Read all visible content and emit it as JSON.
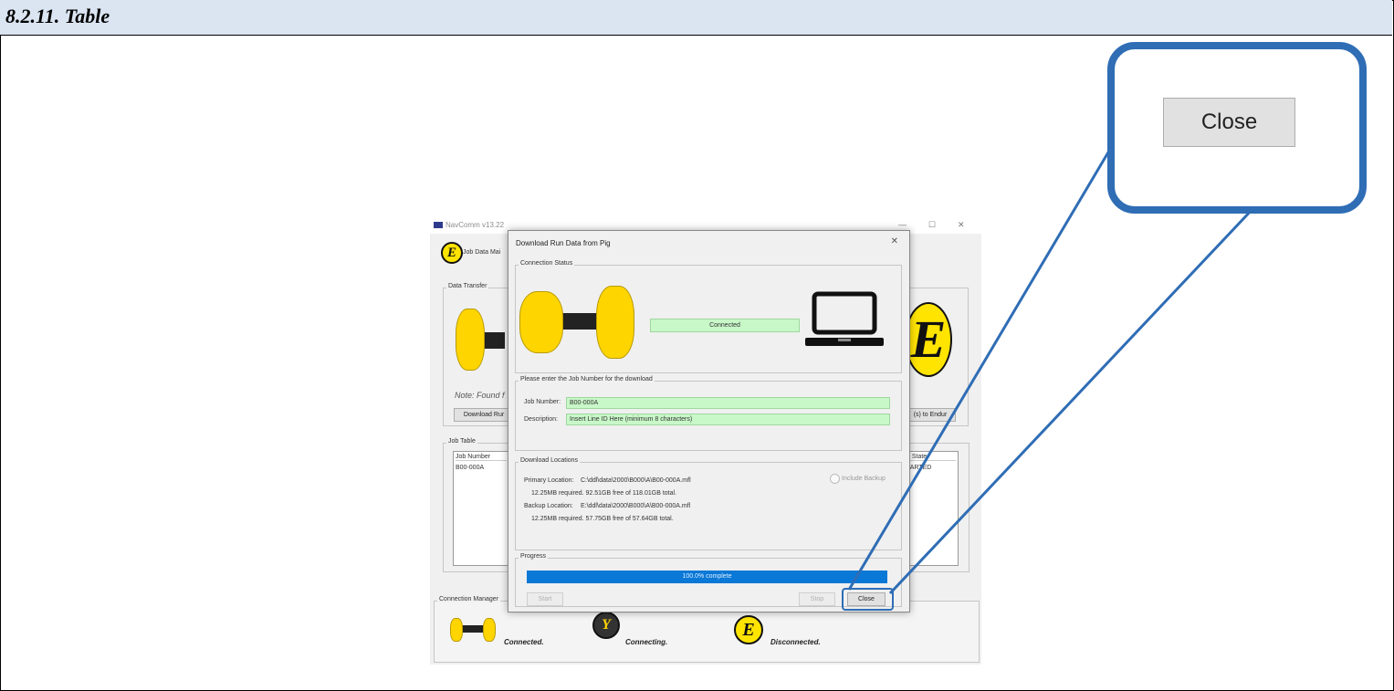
{
  "heading": "8.2.11. Table",
  "app": {
    "title": "NavComm v13.22",
    "job_data_label": "Job Data Mai",
    "data_transfer_label": "Data Transfer",
    "note_text": "Note: Found f",
    "download_button": "Download Rur",
    "right_button": "(s) to Endur",
    "job_table_label": "Job Table",
    "job_table_headers": [
      "Job Number",
      "d State"
    ],
    "job_table_rows": [
      [
        "B00-000A",
        "TARTED"
      ]
    ],
    "connection_manager_label": "Connection Manager",
    "connected_text": "Connected.",
    "connecting_text": "Connecting.",
    "disconnected_text": "Disconnected."
  },
  "dialog": {
    "title": "Download Run Data from Pig",
    "connection_status_label": "Connection Status",
    "status_value": "Connected",
    "job_section_label": "Please enter the Job Number for the download",
    "job_number_label": "Job Number:",
    "job_number_value": "B00-000A",
    "description_label": "Description:",
    "description_value": "Insert Line ID Here (minimum 8 characters)",
    "download_locations_label": "Download Locations",
    "primary_location_label": "Primary Location:",
    "primary_location_value": "C:\\ddl\\data\\2000\\B000\\A\\B00-000A.mfl",
    "primary_space": "12.25MB required. 92.51GB free of 118.01GB total.",
    "include_backup_label": "Include Backup",
    "backup_location_label": "Backup Location:",
    "backup_location_value": "E:\\ddl\\data\\2000\\B000\\A\\B00-000A.mfl",
    "backup_space": "12.25MB required. 57.75GB free of 57.64GB total.",
    "progress_label": "Progress",
    "progress_text": "100.0% complete",
    "progress_fraction": 1.0,
    "start_button": "Start",
    "stop_button": "Stop",
    "close_button": "Close"
  },
  "callout": {
    "close_button": "Close"
  },
  "colors": {
    "accent": "#2f6db5",
    "heading_bg": "#dbe5f1",
    "progress": "#0a78d7",
    "status_green": "#c8f7c8",
    "pig_yellow": "#ffd500"
  }
}
